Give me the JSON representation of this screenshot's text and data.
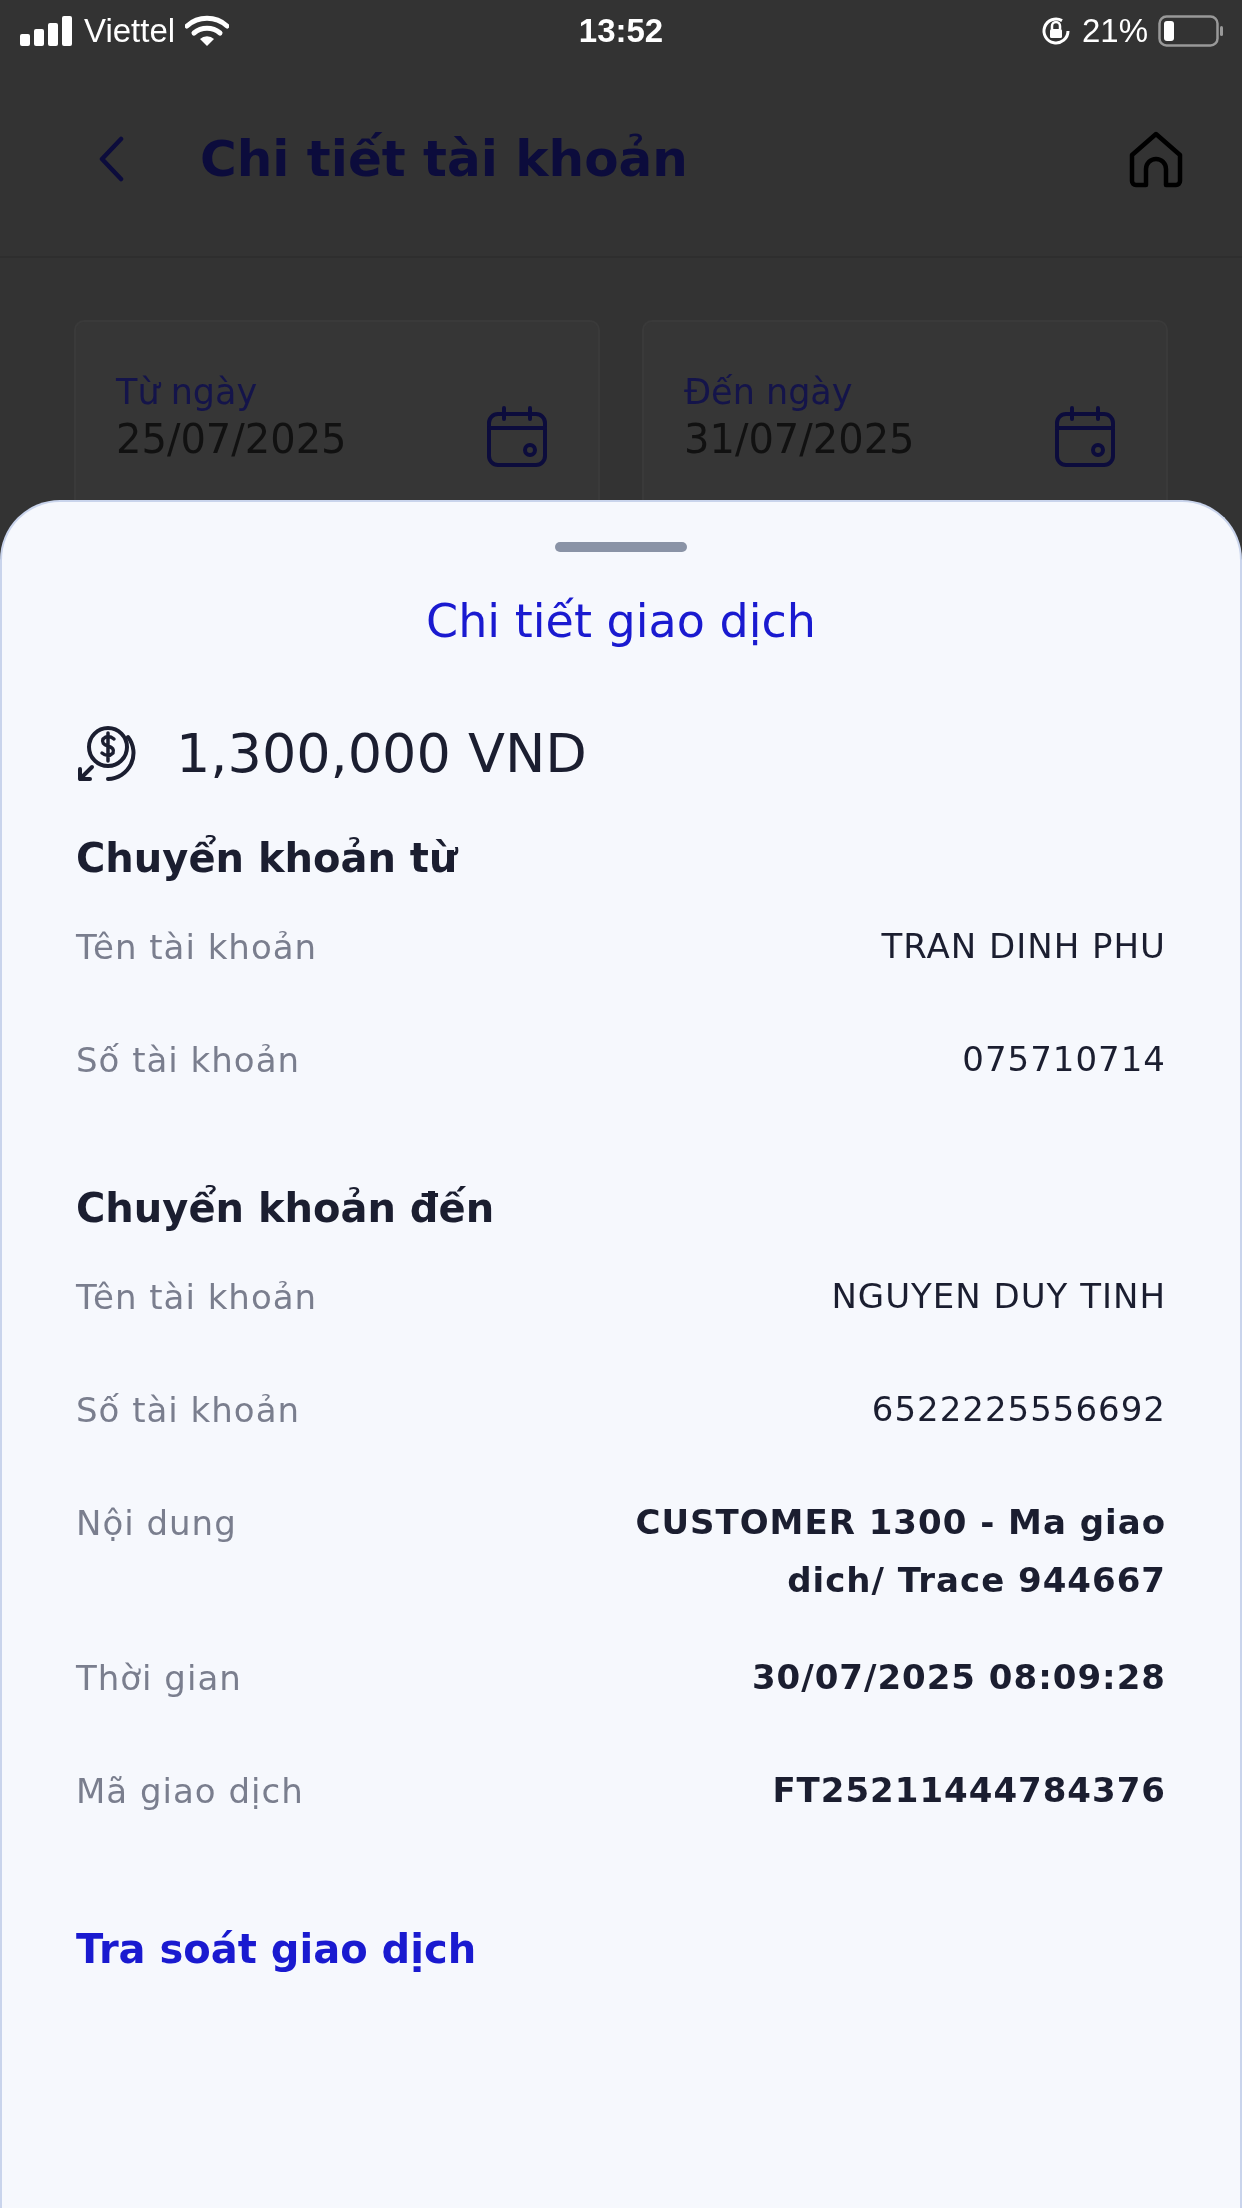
{
  "status_bar": {
    "carrier": "Viettel",
    "time": "13:52",
    "battery": "21%"
  },
  "header": {
    "title": "Chi tiết tài khoản"
  },
  "date_filters": [
    {
      "label": "Từ ngày",
      "value": "25/07/2025"
    },
    {
      "label": "Đến ngày",
      "value": "31/07/2025"
    }
  ],
  "sheet": {
    "title": "Chi tiết giao dịch",
    "amount": "1,300,000 VND",
    "sections": [
      {
        "heading": "Chuyển khoản từ",
        "rows": [
          {
            "label": "Tên tài khoản",
            "value": "TRAN DINH PHU",
            "kind": "plain"
          },
          {
            "label": "Số tài khoản",
            "value": "075710714",
            "kind": "plain"
          }
        ]
      },
      {
        "heading": "Chuyển khoản đến",
        "rows": [
          {
            "label": "Tên tài khoản",
            "value": "NGUYEN DUY TINH",
            "kind": "plain"
          },
          {
            "label": "Số tài khoản",
            "value": "6522225556692",
            "kind": "plain"
          },
          {
            "label": "Nội dung",
            "value": "CUSTOMER 1300 - Ma giao dich/ Trace 944667",
            "kind": "bold"
          },
          {
            "label": "Thời gian",
            "value": "30/07/2025 08:09:28",
            "kind": "bold"
          },
          {
            "label": "Mã giao dịch",
            "value": "FT25211444784376",
            "kind": "bold"
          }
        ]
      }
    ],
    "link": "Tra soát giao dịch"
  }
}
